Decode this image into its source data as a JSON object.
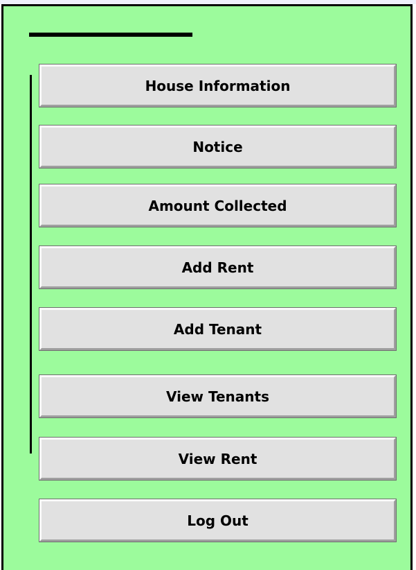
{
  "menu": {
    "buttons": [
      {
        "label": "House Information"
      },
      {
        "label": "Notice"
      },
      {
        "label": "Amount Collected"
      },
      {
        "label": "Add Rent"
      },
      {
        "label": "Add Tenant"
      },
      {
        "label": "View Tenants"
      },
      {
        "label": "View Rent"
      },
      {
        "label": "Log Out"
      }
    ]
  },
  "colors": {
    "panel_background": "#9cfb9c",
    "button_face": "#e1e1e1",
    "text": "#000000"
  }
}
